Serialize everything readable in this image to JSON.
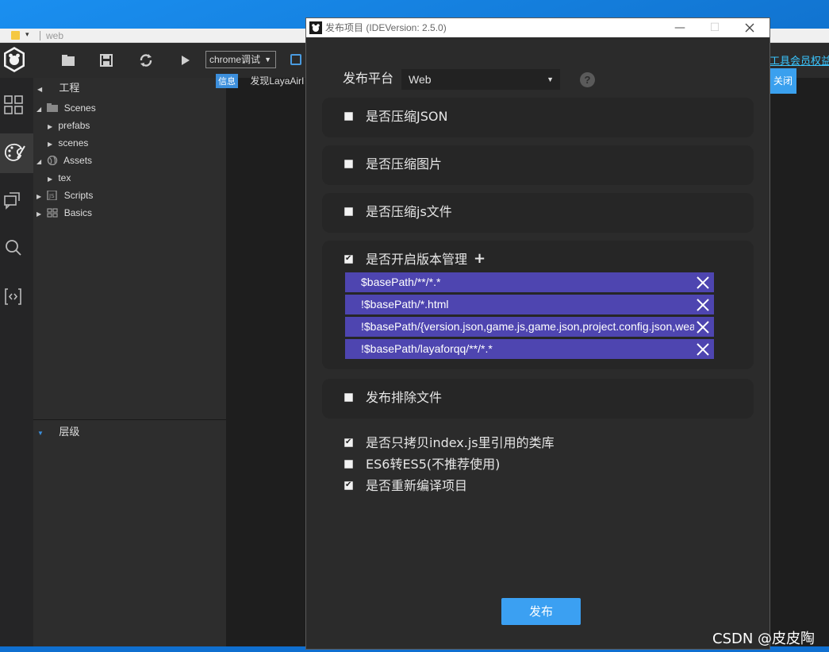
{
  "background_window": {
    "title": "web",
    "toolbar": {
      "debug_select_value": "chrome调试"
    },
    "explorer": {
      "project_label": "工程",
      "tree": [
        {
          "label": "Scenes",
          "expanded": true
        },
        {
          "label": "prefabs",
          "expanded": false
        },
        {
          "label": "scenes",
          "expanded": false
        },
        {
          "label": "Assets",
          "expanded": true
        },
        {
          "label": "tex",
          "expanded": false
        },
        {
          "label": "Scripts",
          "expanded": false
        },
        {
          "label": "Basics",
          "expanded": false
        }
      ],
      "layers_label": "层级"
    },
    "info_badge": "信息",
    "info_text": "发现LayaAirI",
    "vip_link": "工具会员权益",
    "close_banner_label": "关闭"
  },
  "dialog": {
    "title": "发布项目 (IDEVersion: 2.5.0)",
    "platform_label": "发布平台",
    "platform_value": "Web",
    "help_icon": "?",
    "options": {
      "compress_json": {
        "label": "是否压缩JSON",
        "checked": false
      },
      "compress_images": {
        "label": "是否压缩图片",
        "checked": false
      },
      "compress_js": {
        "label": "是否压缩js文件",
        "checked": false
      },
      "version_management": {
        "label": "是否开启版本管理",
        "checked": true,
        "add_label": "+"
      },
      "exclude_files": {
        "label": "发布排除文件",
        "checked": false
      },
      "copy_referenced_libs": {
        "label": "是否只拷贝index.js里引用的类库",
        "checked": true
      },
      "es6_to_es5": {
        "label": "ES6转ES5(不推荐使用)",
        "checked": false
      },
      "recompile": {
        "label": "是否重新编译项目",
        "checked": true
      }
    },
    "version_rules": [
      "$basePath/**/*.*",
      "!$basePath/*.html",
      "!$basePath/{version.json,game.js,game.json,project.config.json,weapp-adapter.js}",
      "!$basePath/layaforqq/**/*.*"
    ],
    "publish_label": "发布"
  },
  "watermark": "CSDN @皮皮陶",
  "colors": {
    "rule_bg": "#4e45b0",
    "publish_bg": "#3ba0f2",
    "panel_bg": "#262626",
    "dialog_bg": "#2b2b2b"
  }
}
